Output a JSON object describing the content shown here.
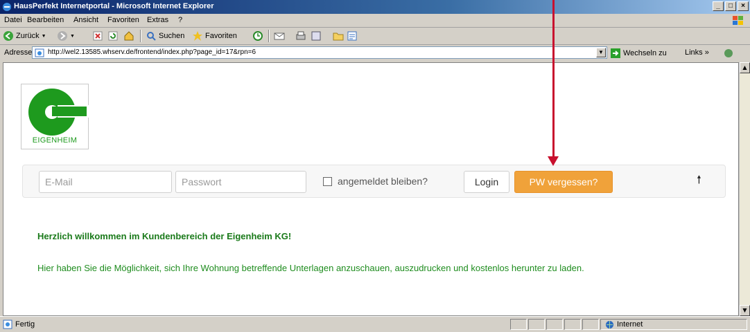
{
  "window": {
    "title": "HausPerfekt Internetportal - Microsoft Internet Explorer"
  },
  "menu": [
    "Datei",
    "Bearbeiten",
    "Ansicht",
    "Favoriten",
    "Extras",
    "?"
  ],
  "toolbar": {
    "back": "Zurück",
    "search": "Suchen",
    "favorites": "Favoriten"
  },
  "address": {
    "label": "Adresse",
    "url": "http://wel2.13585.whserv.de/frontend/index.php?page_id=17&rpn=6",
    "go": "Wechseln zu",
    "links": "Links"
  },
  "page": {
    "logo_text": "EIGENHEIM",
    "login": {
      "email_placeholder": "E-Mail",
      "password_placeholder": "Passwort",
      "remember_label": "angemeldet bleiben?",
      "login_button": "Login",
      "forgot_button": "PW vergessen?",
      "up_arrow": "🠕"
    },
    "welcome": "Herzlich willkommen im Kundenbereich der Eigenheim KG!",
    "intro": "Hier haben Sie die Möglichkeit, sich Ihre Wohnung betreffende Unterlagen anzuschauen, auszudrucken und kostenlos herunter zu laden."
  },
  "status": {
    "left": "Fertig",
    "zone": "Internet"
  },
  "colors": {
    "accent": "#f0a23a",
    "brand_green": "#1e9a1e",
    "annotation_red": "#c8102e"
  }
}
